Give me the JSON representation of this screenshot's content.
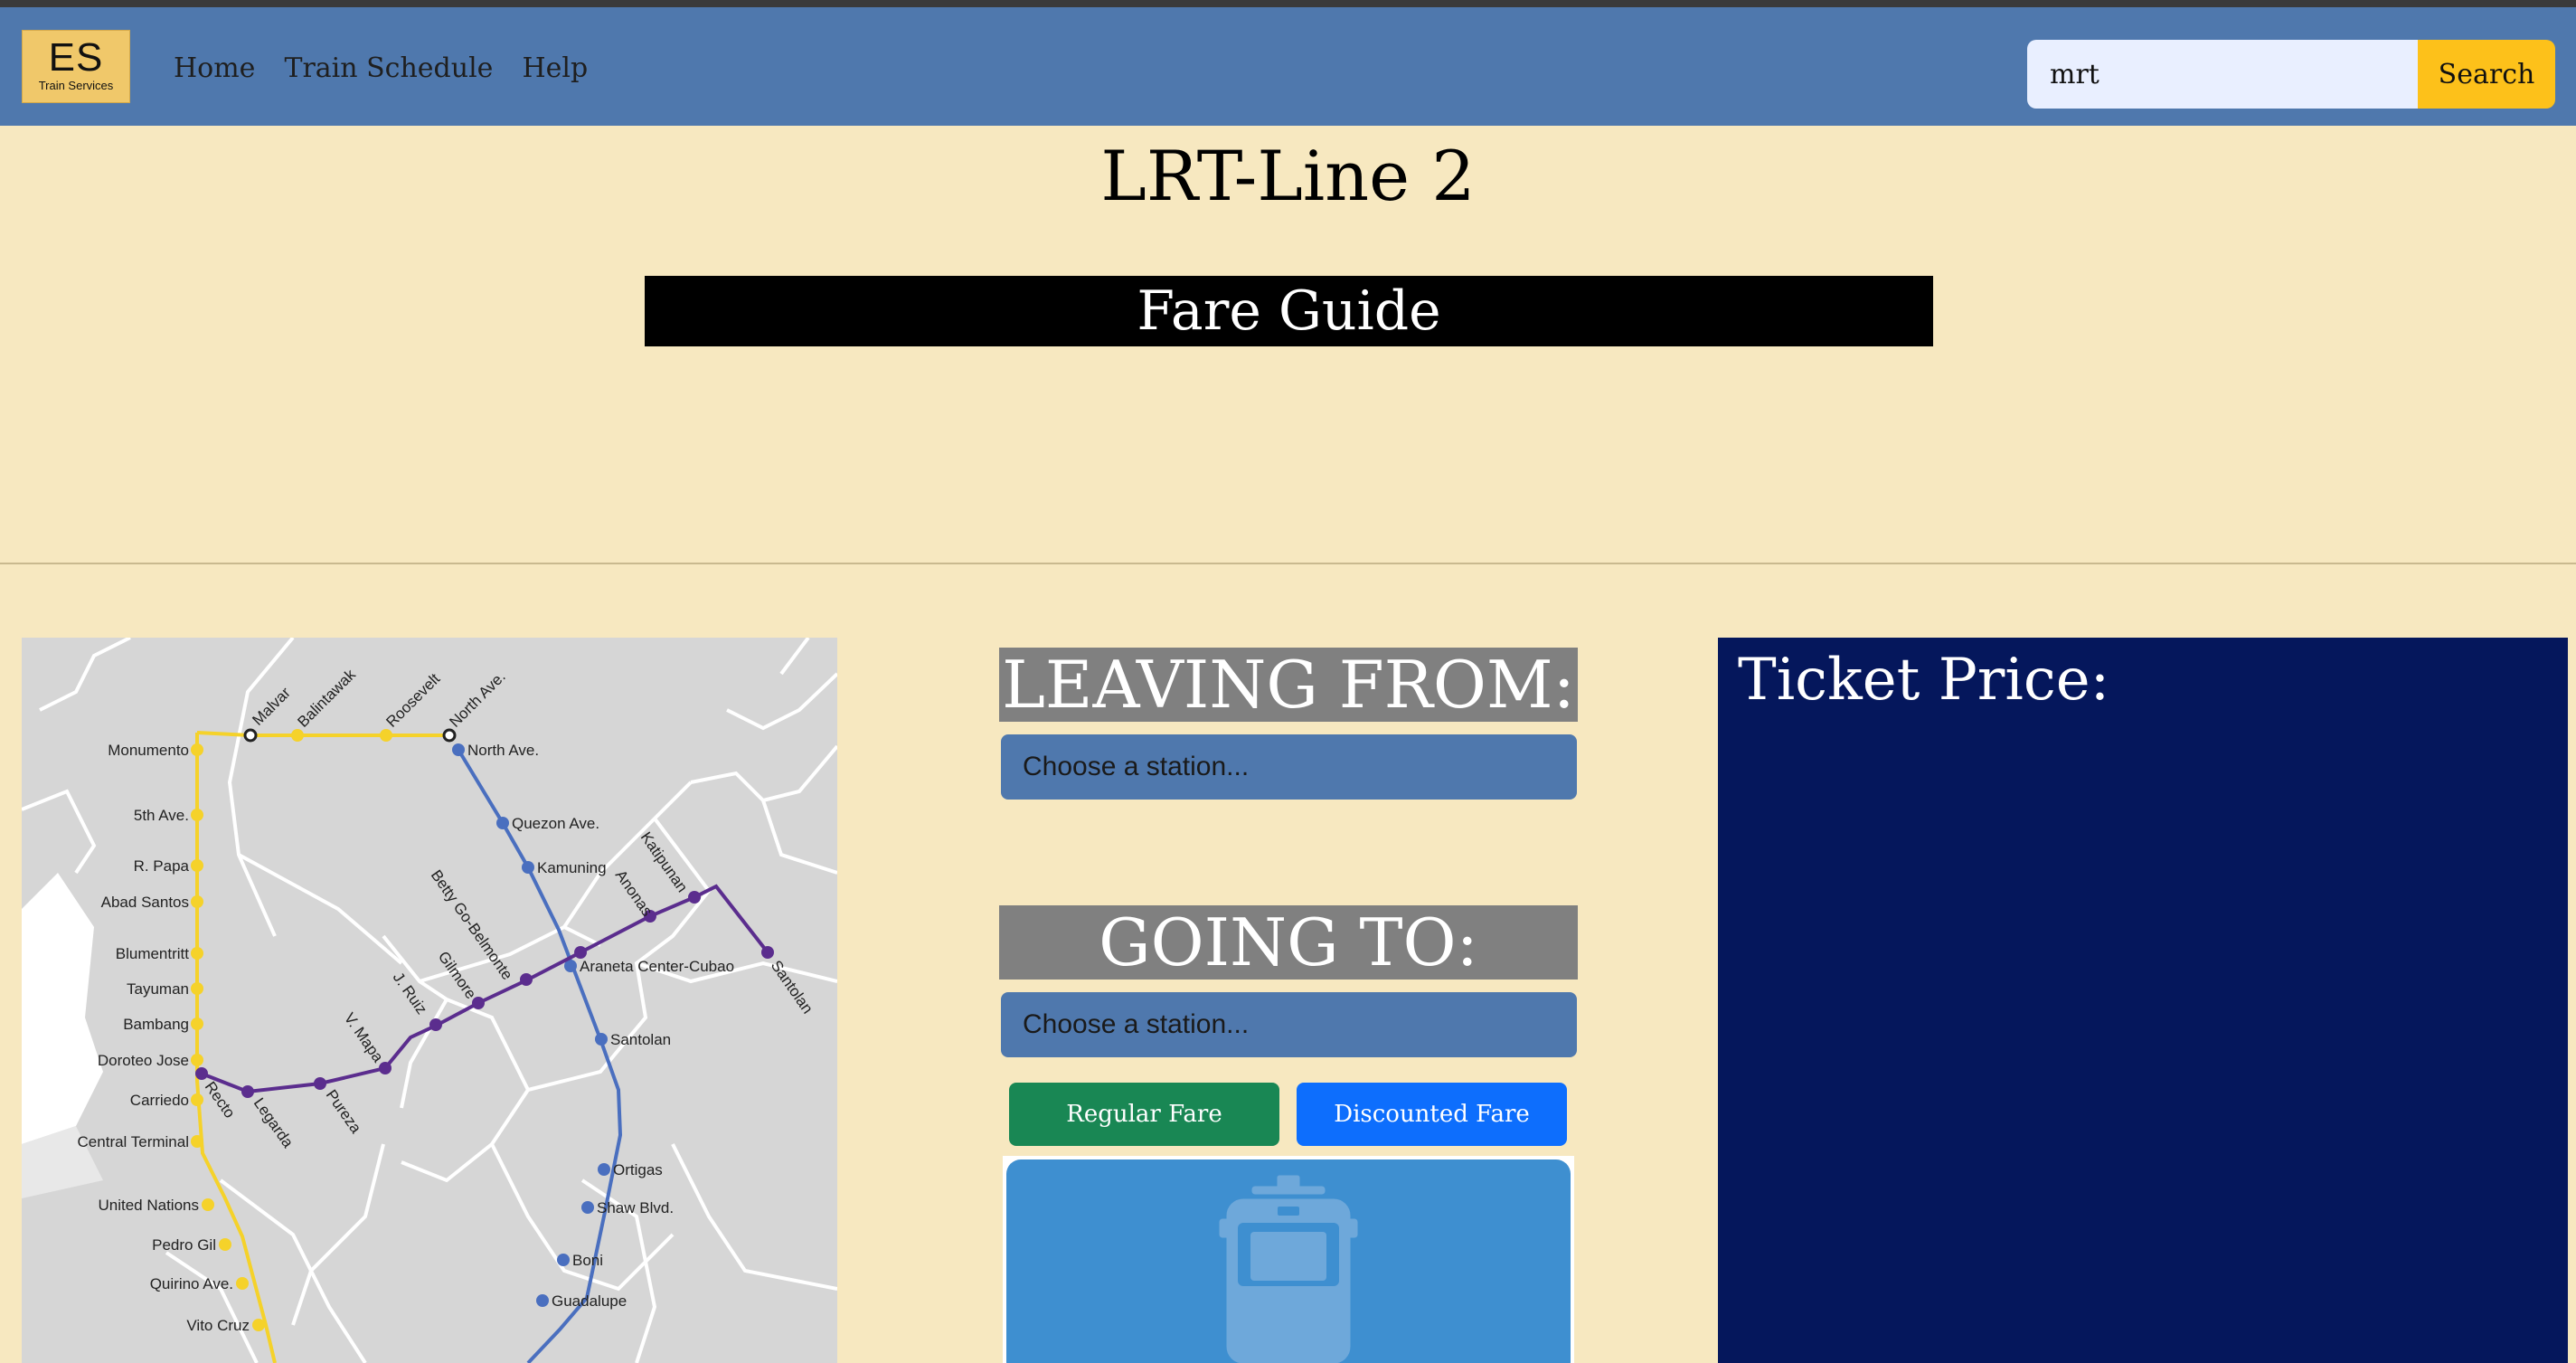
{
  "navbar": {
    "logo_main": "ES",
    "logo_sub": "Train Services",
    "links": [
      "Home",
      "Train Schedule",
      "Help"
    ],
    "search_value": "mrt",
    "search_button": "Search",
    "bg_color": "#4f78ad"
  },
  "page": {
    "title": "LRT-Line 2",
    "banner": "Fare Guide"
  },
  "form": {
    "leaving_label": "LEAVING FROM:",
    "leaving_select": "Choose a station...",
    "going_label": "GOING TO:",
    "going_select": "Choose a station...",
    "regular_button": "Regular Fare",
    "discount_button": "Discounted Fare"
  },
  "ticket": {
    "label": "Ticket Price:"
  },
  "map": {
    "line1_stations": [
      "Monumento",
      "5th Ave.",
      "R. Papa",
      "Abad Santos",
      "Blumentritt",
      "Tayuman",
      "Bambang",
      "Doroteo Jose",
      "Carriedo",
      "Central Terminal",
      "United Nations",
      "Pedro Gil",
      "Quirino Ave.",
      "Vito Cruz"
    ],
    "line2_stations": [
      "Recto",
      "Legarda",
      "Pureza",
      "V. Mapa",
      "J. Ruiz",
      "Gilmore",
      "Betty Go-Belmonte",
      "Anonas",
      "Katipunan",
      "Santolan"
    ],
    "line3_stations": [
      "North Ave.",
      "Quezon Ave.",
      "Kamuning",
      "Araneta Center-Cubao",
      "Santolan",
      "Ortigas",
      "Shaw Blvd.",
      "Boni",
      "Guadalupe"
    ],
    "extension_stations": [
      "Malvar",
      "Balintawak",
      "Roosevelt",
      "North Ave."
    ],
    "colors": {
      "line1": "#f5d22a",
      "line2": "#5b2d8e",
      "line3": "#4a6fbf"
    }
  },
  "colors": {
    "page_bg": "#f7e8c0",
    "ticket_bg": "#05175c",
    "regular": "#198754",
    "discount": "#0d6efd",
    "search_btn": "#fdc11a"
  }
}
